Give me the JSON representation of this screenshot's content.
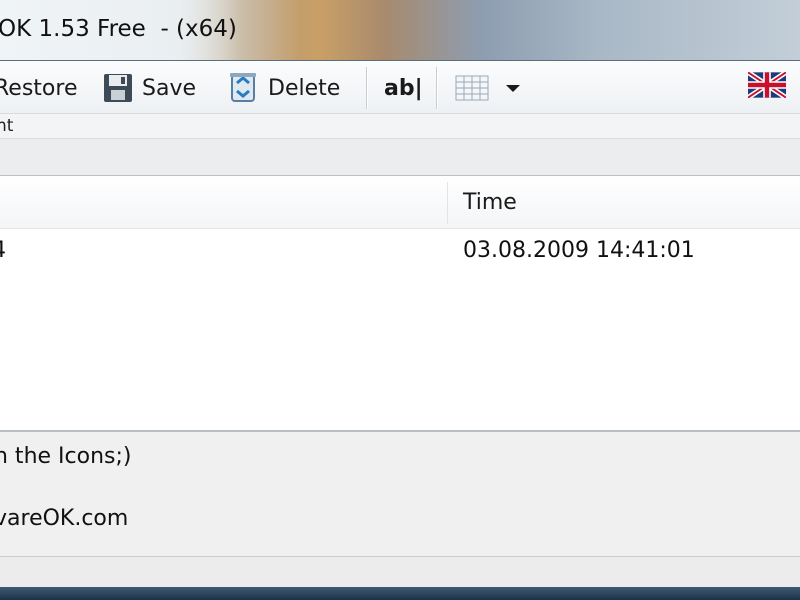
{
  "window": {
    "title": "OK 1.53 Free  - (x64)"
  },
  "toolbar": {
    "restore_label": "Restore",
    "save_label": "Save",
    "delete_label": "Delete",
    "text_tool_label": "ab|",
    "language_icon": "uk-flag-icon"
  },
  "strip": {
    "tab_text": "nt"
  },
  "list": {
    "columns": [
      "",
      "Time"
    ],
    "rows": [
      {
        "name": "4",
        "time": "03.08.2009 14:41:01"
      }
    ]
  },
  "info": {
    "line1": "h the Icons;)",
    "line2": "vareOK.com"
  },
  "colors": {
    "toolbar_bg": "#f4f6f8",
    "list_bg": "#ffffff",
    "panel_bg": "#f0f0f0"
  }
}
